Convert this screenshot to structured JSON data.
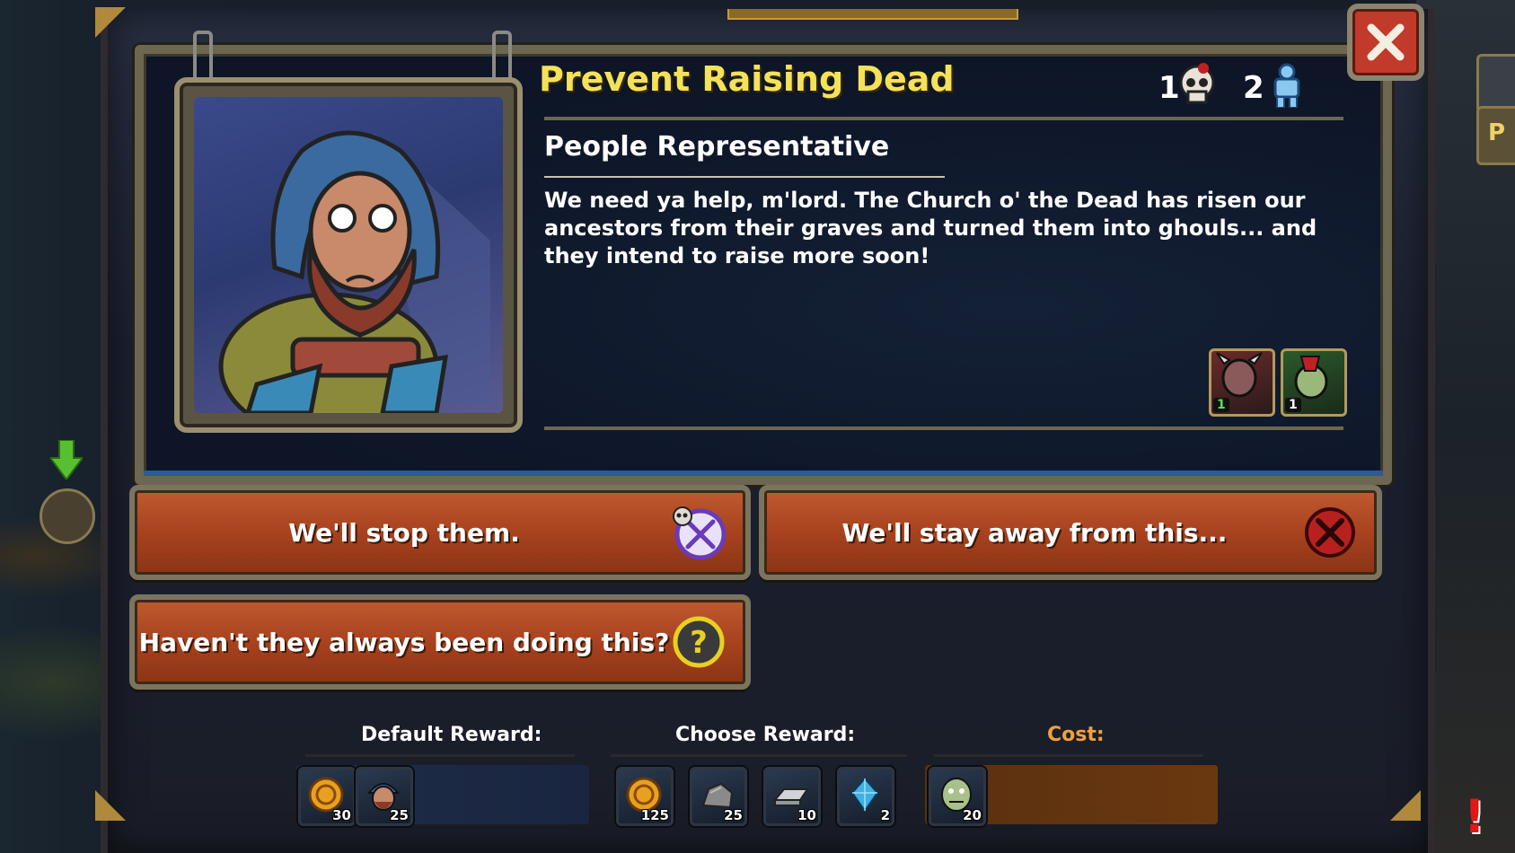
{
  "quest": {
    "title": "Prevent Raising Dead",
    "stats": {
      "dead_count": "1",
      "dead_icon": "skull-icon",
      "soldier_count": "2",
      "soldier_icon": "knight-icon"
    },
    "npc_name": "People Representative",
    "text": "We need ya help, m'lord. The Church o' the Dead has risen our ancestors from their graves and turned them into ghouls... and they intend to raise more soon!",
    "enemies": [
      {
        "icon": "demon-knight-icon",
        "count": "1"
      },
      {
        "icon": "ghoul-warrior-icon",
        "count": "1"
      }
    ]
  },
  "choices": {
    "stop": {
      "label": "We'll stop them.",
      "icon": "skull-swords-icon"
    },
    "away": {
      "label": "We'll stay away from this...",
      "icon": "red-x-icon"
    },
    "always": {
      "label": "Haven't they always been doing this?",
      "icon": "question-icon"
    }
  },
  "rewards": {
    "default_heading": "Default Reward:",
    "choose_heading": "Choose Reward:",
    "cost_heading": "Cost:",
    "default_items": [
      {
        "icon": "gold-coin-icon",
        "qty": "30"
      },
      {
        "icon": "peasant-icon",
        "qty": "25"
      }
    ],
    "choose_items": [
      {
        "icon": "gold-coin-icon",
        "qty": "125"
      },
      {
        "icon": "stone-icon",
        "qty": "25"
      },
      {
        "icon": "iron-ingot-icon",
        "qty": "10"
      },
      {
        "icon": "crystal-icon",
        "qty": "2"
      }
    ],
    "cost_items": [
      {
        "icon": "ghoul-icon",
        "qty": "20"
      }
    ]
  },
  "side": {
    "tab_letter": "P",
    "alert": "!"
  },
  "colors": {
    "title": "#f3e25a",
    "button": "#a8421f",
    "cost_heading": "#f0a040",
    "close": "#c23a2a"
  }
}
